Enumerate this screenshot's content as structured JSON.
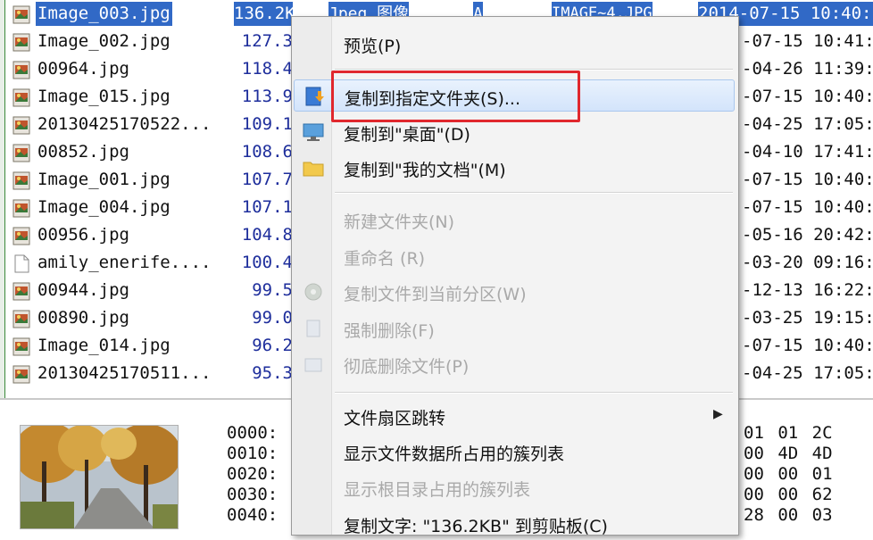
{
  "colors": {
    "selection": "#3169c6",
    "highlight_box": "#e0272d",
    "size_text": "#1e2e9c"
  },
  "files": [
    {
      "name": "Image_003.jpg",
      "size": "136.2KB",
      "type": "Jpeg 图像",
      "attr": "A",
      "desc": "IMAGE~4.JPG",
      "date": "2014-07-15 10:40:",
      "selected": true
    },
    {
      "name": "Image_002.jpg",
      "size": "127.3",
      "date": "-07-15 10:41:"
    },
    {
      "name": "00964.jpg",
      "size": "118.4",
      "date": "-04-26 11:39:"
    },
    {
      "name": "Image_015.jpg",
      "size": "113.9",
      "date": "-07-15 10:40:"
    },
    {
      "name": "20130425170522...",
      "size": "109.1",
      "date": "-04-25 17:05:"
    },
    {
      "name": "00852.jpg",
      "size": "108.6",
      "date": "-04-10 17:41:"
    },
    {
      "name": "Image_001.jpg",
      "size": "107.7",
      "date": "-07-15 10:40:"
    },
    {
      "name": "Image_004.jpg",
      "size": "107.1",
      "date": "-07-15 10:40:"
    },
    {
      "name": "00956.jpg",
      "size": "104.8",
      "date": "-05-16 20:42:"
    },
    {
      "name": "amily_enerife....",
      "size": "100.4",
      "date": "-03-20 09:16:",
      "plain": true
    },
    {
      "name": "00944.jpg",
      "size": "99.5",
      "date": "-12-13 16:22:"
    },
    {
      "name": "00890.jpg",
      "size": "99.0",
      "date": "-03-25 19:15:"
    },
    {
      "name": "Image_014.jpg",
      "size": "96.2",
      "date": "-07-15 10:40:"
    },
    {
      "name": "20130425170511...",
      "size": "95.3",
      "date": "-04-25 17:05:"
    }
  ],
  "hex": {
    "addresses": [
      "0000:",
      "0010:",
      "0020:",
      "0030:",
      "0040:"
    ],
    "right_bytes": [
      "01 01 2C",
      "00 4D 4D",
      "00 00 01",
      "00 00 62",
      "28 00 03"
    ]
  },
  "menu": {
    "preview": "预览(P)",
    "copy_to_folder": "复制到指定文件夹(S)...",
    "copy_to_desktop": "复制到\"桌面\"(D)",
    "copy_to_documents": "复制到\"我的文档\"(M)",
    "new_folder": "新建文件夹(N)",
    "rename": "重命名 (R)",
    "copy_to_partition": "复制文件到当前分区(W)",
    "force_delete": "强制删除(F)",
    "wipe_delete": "彻底删除文件(P)",
    "sector_jump": "文件扇区跳转",
    "show_cluster_list": "显示文件数据所占用的簇列表",
    "show_root_cluster_list": "显示根目录占用的簇列表",
    "copy_text": "复制文字: \"136.2KB\" 到剪贴板(C)"
  }
}
